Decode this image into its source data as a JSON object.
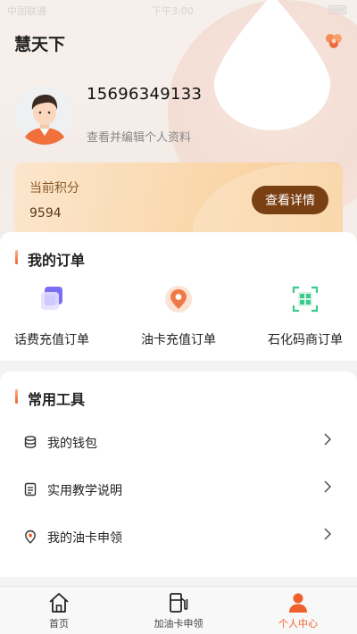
{
  "status_bar": {
    "carrier": "中国联通",
    "time": "下午3:00"
  },
  "header": {
    "title": "慧天下",
    "settings_icon": "flower-settings-icon"
  },
  "profile": {
    "phone": "15696349133",
    "edit_link": "查看并编辑个人资料",
    "avatar_icon": "user-avatar-icon"
  },
  "points": {
    "label": "当前积分",
    "value": "9594",
    "detail_button": "查看详情"
  },
  "orders": {
    "title": "我的订单",
    "items": [
      {
        "label": "话费充值订单",
        "icon": "phone-recharge-icon"
      },
      {
        "label": "油卡充值订单",
        "icon": "fuel-card-icon"
      },
      {
        "label": "石化码商订单",
        "icon": "qr-code-icon"
      }
    ]
  },
  "tools": {
    "title": "常用工具",
    "items": [
      {
        "label": "我的钱包",
        "icon": "wallet-icon"
      },
      {
        "label": "实用教学说明",
        "icon": "document-icon"
      },
      {
        "label": "我的油卡申领",
        "icon": "location-pin-icon"
      }
    ]
  },
  "tabbar": {
    "items": [
      {
        "label": "首页",
        "icon": "home-icon"
      },
      {
        "label": "加油卡申领",
        "icon": "fuel-pump-icon"
      },
      {
        "label": "个人中心",
        "icon": "person-icon"
      }
    ],
    "active_index": 2
  },
  "colors": {
    "accent": "#f0602d",
    "detail_button_bg": "#7a3f12"
  }
}
